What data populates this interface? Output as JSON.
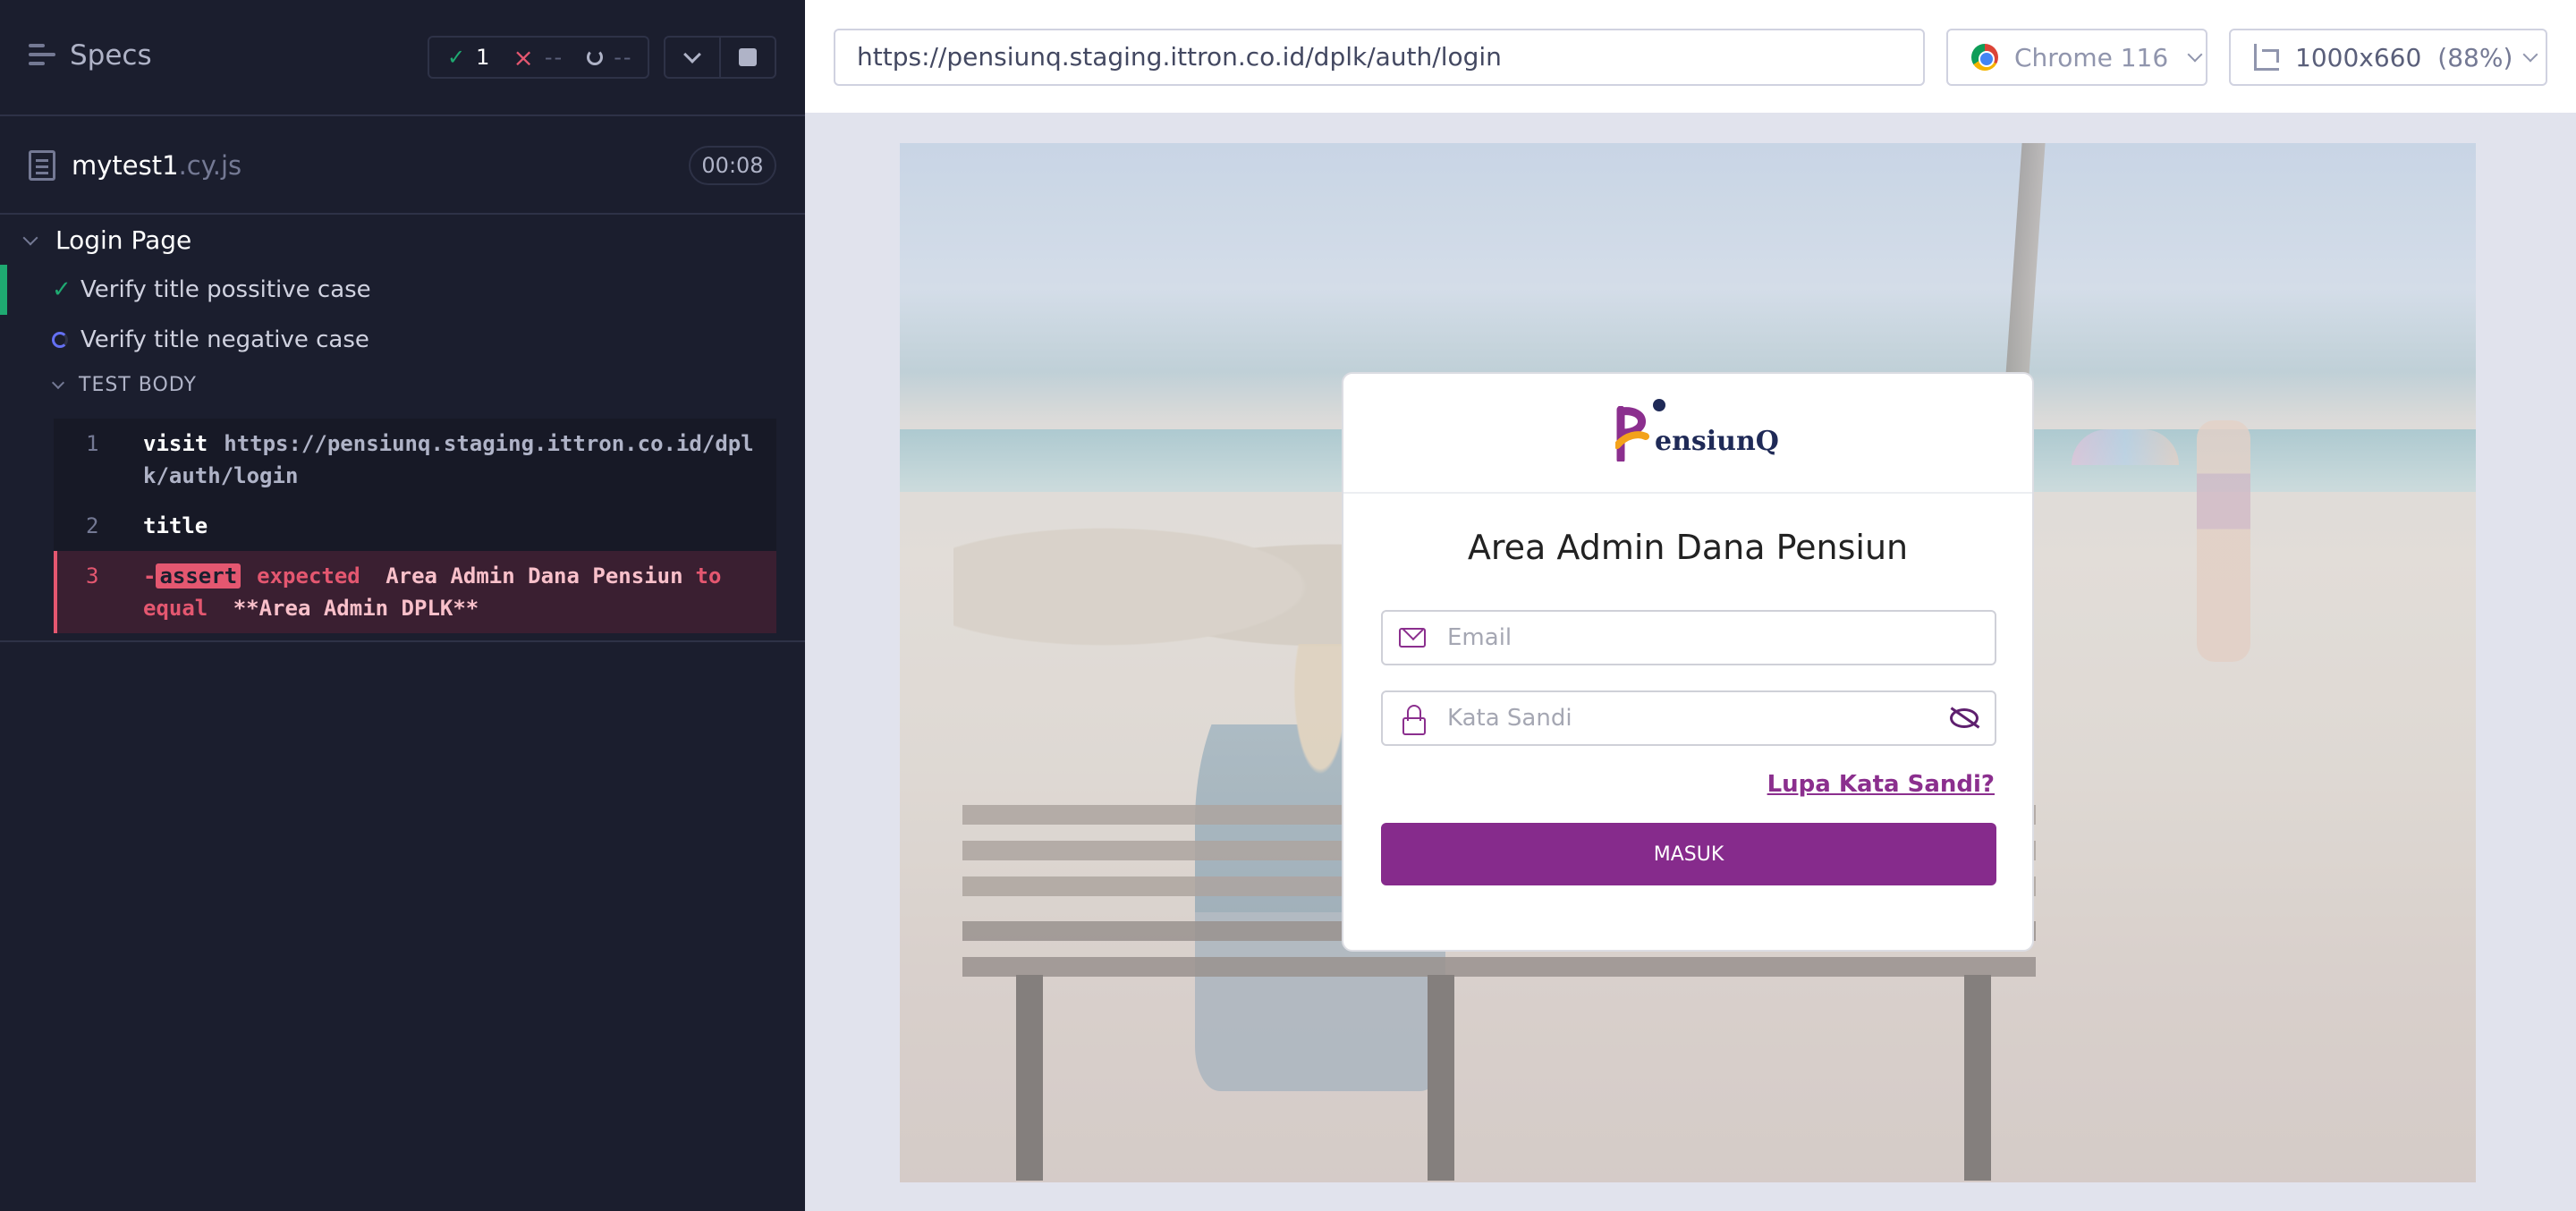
{
  "reporter": {
    "specs_label": "Specs",
    "stats": {
      "passed": "1",
      "failed": "--",
      "pending": "--"
    },
    "file": {
      "name": "mytest1",
      "ext": ".cy.js",
      "duration": "00:08"
    },
    "suite": {
      "title": "Login Page",
      "tests": [
        {
          "label": "Verify title possitive case",
          "state": "passed"
        },
        {
          "label": "Verify title negative case",
          "state": "running"
        }
      ],
      "test_body_label": "TEST BODY",
      "commands": [
        {
          "num": "1",
          "name": "visit",
          "message": "https://pensiunq.staging.ittron.co.id/dplk/auth/login"
        },
        {
          "num": "2",
          "name": "title",
          "message": ""
        },
        {
          "num": "3",
          "name": "-assert",
          "expected": "expected",
          "actual": "Area Admin Dana Pensiun",
          "to_equal": "to equal",
          "expected_value": "**Area Admin DPLK**"
        }
      ]
    }
  },
  "aut_header": {
    "url": "https://pensiunq.staging.ittron.co.id/dplk/auth/login",
    "browser": "Chrome 116",
    "viewport": "1000x660",
    "zoom": "(88%)"
  },
  "app": {
    "logo_text": "ensiunQ",
    "title": "Area Admin Dana Pensiun",
    "email_placeholder": "Email",
    "password_placeholder": "Kata Sandi",
    "forgot_label": "Lupa Kata Sandi?",
    "submit_label": "MASUK",
    "colors": {
      "brand": "#862b8c",
      "brand_dark": "#1f2a57"
    }
  },
  "colors": {
    "reporter_bg": "#1b1e2e",
    "pass": "#1fa971",
    "fail": "#e45770",
    "running": "#6470f3"
  }
}
